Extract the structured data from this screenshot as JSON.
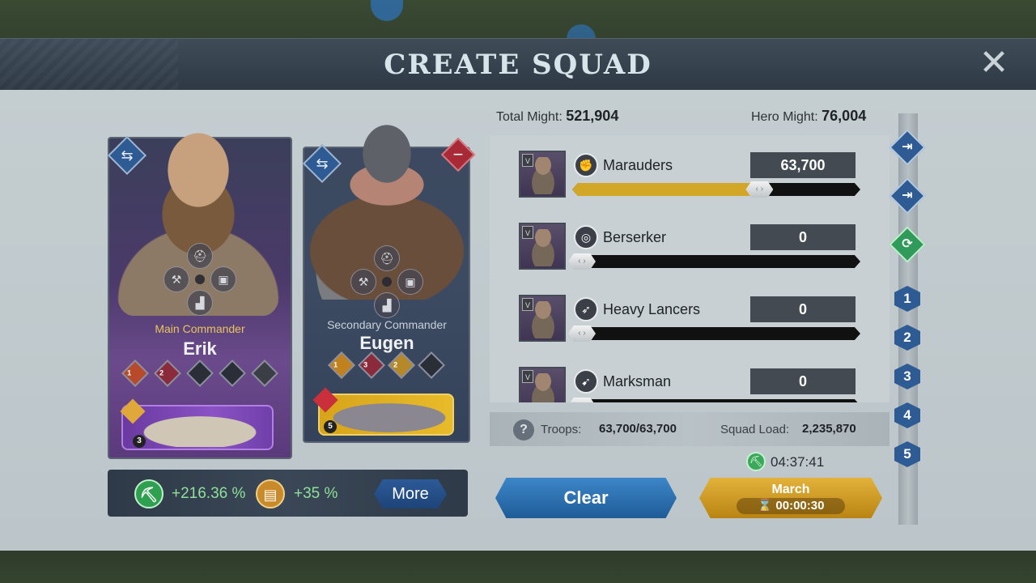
{
  "title": "CREATE SQUAD",
  "close_icon": "close-icon",
  "commanders": {
    "main": {
      "role": "Main Commander",
      "name": "Erik",
      "skill_levels": [
        "1",
        "2"
      ],
      "pet_level": "3"
    },
    "secondary": {
      "role": "Secondary Commander",
      "name": "Eugen",
      "skill_levels": [
        "1",
        "3",
        "2"
      ],
      "pet_level": "5"
    }
  },
  "bonuses": {
    "gather_bonus": "+216.36 %",
    "load_bonus": "+35 %",
    "more_label": "More"
  },
  "might": {
    "total_label": "Total Might:",
    "total_value": "521,904",
    "hero_label": "Hero Might:",
    "hero_value": "76,004"
  },
  "troops": [
    {
      "name": "Marauders",
      "count": "63,700",
      "fill_fraction": 0.65,
      "tier": "V"
    },
    {
      "name": "Berserker",
      "count": "0",
      "fill_fraction": 0,
      "tier": "V"
    },
    {
      "name": "Heavy Lancers",
      "count": "0",
      "fill_fraction": 0,
      "tier": "V"
    },
    {
      "name": "Marksman",
      "count": "0",
      "fill_fraction": 0,
      "tier": "V"
    }
  ],
  "footer": {
    "troops_label": "Troops:",
    "troops_value": "63,700/63,700",
    "load_label": "Squad Load:",
    "load_value": "2,235,870"
  },
  "gather_timer": "04:37:41",
  "actions": {
    "clear_label": "Clear",
    "march_label": "March",
    "march_time": "00:00:30"
  },
  "presets": [
    "1",
    "2",
    "3",
    "4",
    "5"
  ],
  "colors": {
    "accent_blue": "#2e5b94",
    "gold": "#d2a626",
    "green": "#3aa95a",
    "red": "#a82a36"
  }
}
